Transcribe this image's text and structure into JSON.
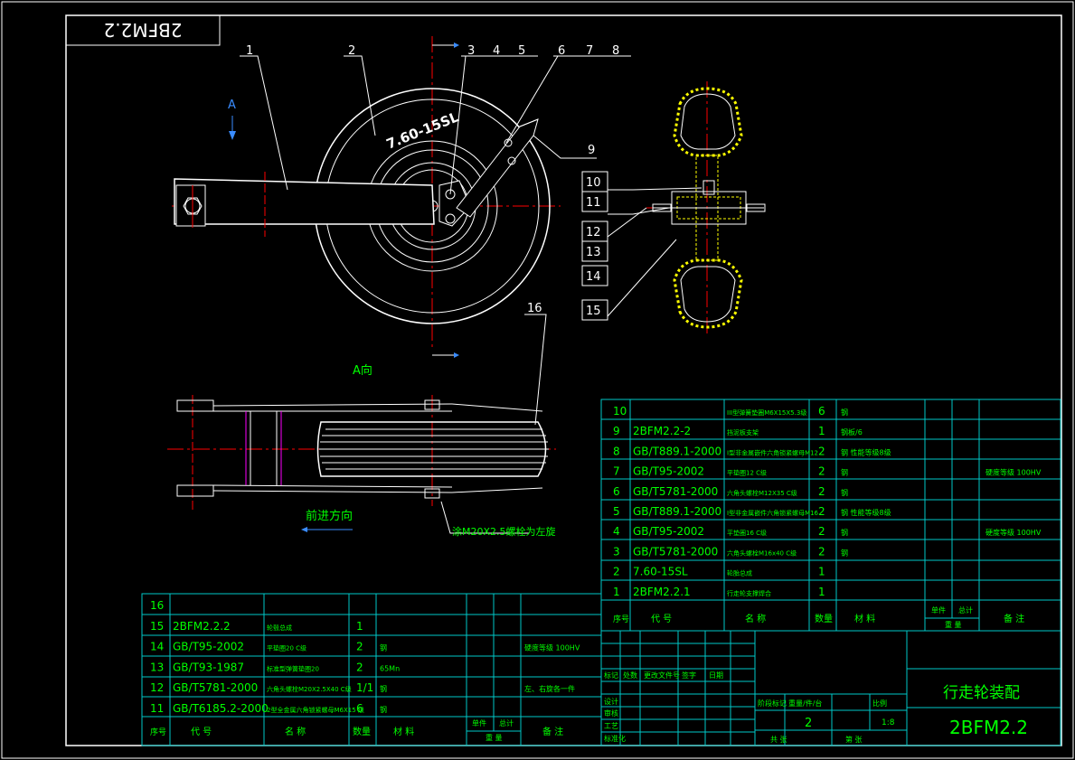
{
  "drawing": {
    "title_mirrored": "2BFM2.2",
    "title_cn": "行走轮装配",
    "drawing_number": "2BFM2.2",
    "scale": "1:8",
    "sheet_count": "2",
    "view_label": "A",
    "view_a_caption": "A向",
    "direction_caption": "前进方向",
    "note_caption": "涂M20X2.5螺栓为左旋",
    "tire_text": "7.60-15SL",
    "balloons_top": [
      "1",
      "2",
      "3",
      "4",
      "5",
      "6",
      "7",
      "8",
      "9"
    ],
    "balloons_side": [
      "10",
      "11",
      "12",
      "13",
      "14",
      "15"
    ],
    "balloon_16": "16"
  },
  "bom_upper": {
    "rows": [
      {
        "no": "10",
        "code": "",
        "name": "III型弹簧垫圈M6X15X5.3级",
        "qty": "6",
        "material": "钢",
        "note": ""
      },
      {
        "no": "9",
        "code": "2BFM2.2-2",
        "name": "挡泥板支架",
        "qty": "1",
        "material": "钢板/6",
        "note": ""
      },
      {
        "no": "8",
        "code": "GB/T889.1-2000",
        "name": "I型非金属嵌件六角锁紧螺母M12",
        "qty": "2",
        "material": "钢 性能等级8级",
        "note": ""
      },
      {
        "no": "7",
        "code": "GB/T95-2002",
        "name": "平垫圈12 C级",
        "qty": "2",
        "material": "钢",
        "note": "硬度等级 100HV"
      },
      {
        "no": "6",
        "code": "GB/T5781-2000",
        "name": "六角头螺栓M12X35 C级",
        "qty": "2",
        "material": "钢",
        "note": ""
      },
      {
        "no": "5",
        "code": "GB/T889.1-2000",
        "name": "I型非金属嵌件六角锁紧螺母M16",
        "qty": "2",
        "material": "钢 性能等级8级",
        "note": ""
      },
      {
        "no": "4",
        "code": "GB/T95-2002",
        "name": "平垫圈16 C级",
        "qty": "2",
        "material": "钢",
        "note": "硬度等级 100HV"
      },
      {
        "no": "3",
        "code": "GB/T5781-2000",
        "name": "六角头螺栓M16x40 C级",
        "qty": "2",
        "material": "钢",
        "note": ""
      },
      {
        "no": "2",
        "code": "7.60-15SL",
        "name": "轮胎总成",
        "qty": "1",
        "material": "",
        "note": ""
      },
      {
        "no": "1",
        "code": "2BFM2.2.1",
        "name": "行走轮支撑焊合",
        "qty": "1",
        "material": "",
        "note": ""
      }
    ],
    "header": {
      "no": "序号",
      "code": "代 号",
      "name": "名 称",
      "qty": "数量",
      "material": "材 料",
      "single": "单件",
      "total": "总计",
      "weight": "重 量",
      "note": "备 注"
    }
  },
  "bom_lower": {
    "rows": [
      {
        "no": "16",
        "code": "",
        "name": "",
        "qty": "",
        "material": "",
        "note": ""
      },
      {
        "no": "15",
        "code": "2BFM2.2.2",
        "name": "轮毂总成",
        "qty": "1",
        "material": "",
        "note": ""
      },
      {
        "no": "14",
        "code": "GB/T95-2002",
        "name": "平垫圈20 C级",
        "qty": "2",
        "material": "钢",
        "note": "硬度等级 100HV"
      },
      {
        "no": "13",
        "code": "GB/T93-1987",
        "name": "标准型弹簧垫圈20",
        "qty": "2",
        "material": "65Mn",
        "note": ""
      },
      {
        "no": "12",
        "code": "GB/T5781-2000",
        "name": "六角头螺栓M20X2.5X40 C级",
        "qty": "1/1",
        "material": "钢",
        "note": "左、右旋各一件"
      },
      {
        "no": "11",
        "code": "GB/T6185.2-2000",
        "name": "2型全金属六角锁紧螺母M6X15 级",
        "qty": "6",
        "material": "钢",
        "note": ""
      }
    ],
    "header": {
      "no": "序号",
      "code": "代 号",
      "name": "名 称",
      "qty": "数量",
      "material": "材 料",
      "single": "单件",
      "total": "总计",
      "weight": "重 量",
      "note": "备 注"
    }
  },
  "title_block": {
    "mark": "标记",
    "count": "处数",
    "zone": "更改文件号",
    "sign": "签字",
    "date": "日期",
    "design": "设计",
    "check": "审核",
    "process": "工艺",
    "standard": "标准化",
    "stage": "阶段标记",
    "weight": "重量/件/台",
    "ratio": "比例",
    "total_sheets": "共 张",
    "sheet": "第 张",
    "approve": "日期",
    "batch": "批准"
  },
  "colors": {
    "line": "#ffffff",
    "table": "#00c8c8",
    "text": "#00ff00",
    "center": "#ff0000",
    "hatch": "#ffff00",
    "magenta": "#ff00ff",
    "blue": "#3a8cff"
  }
}
